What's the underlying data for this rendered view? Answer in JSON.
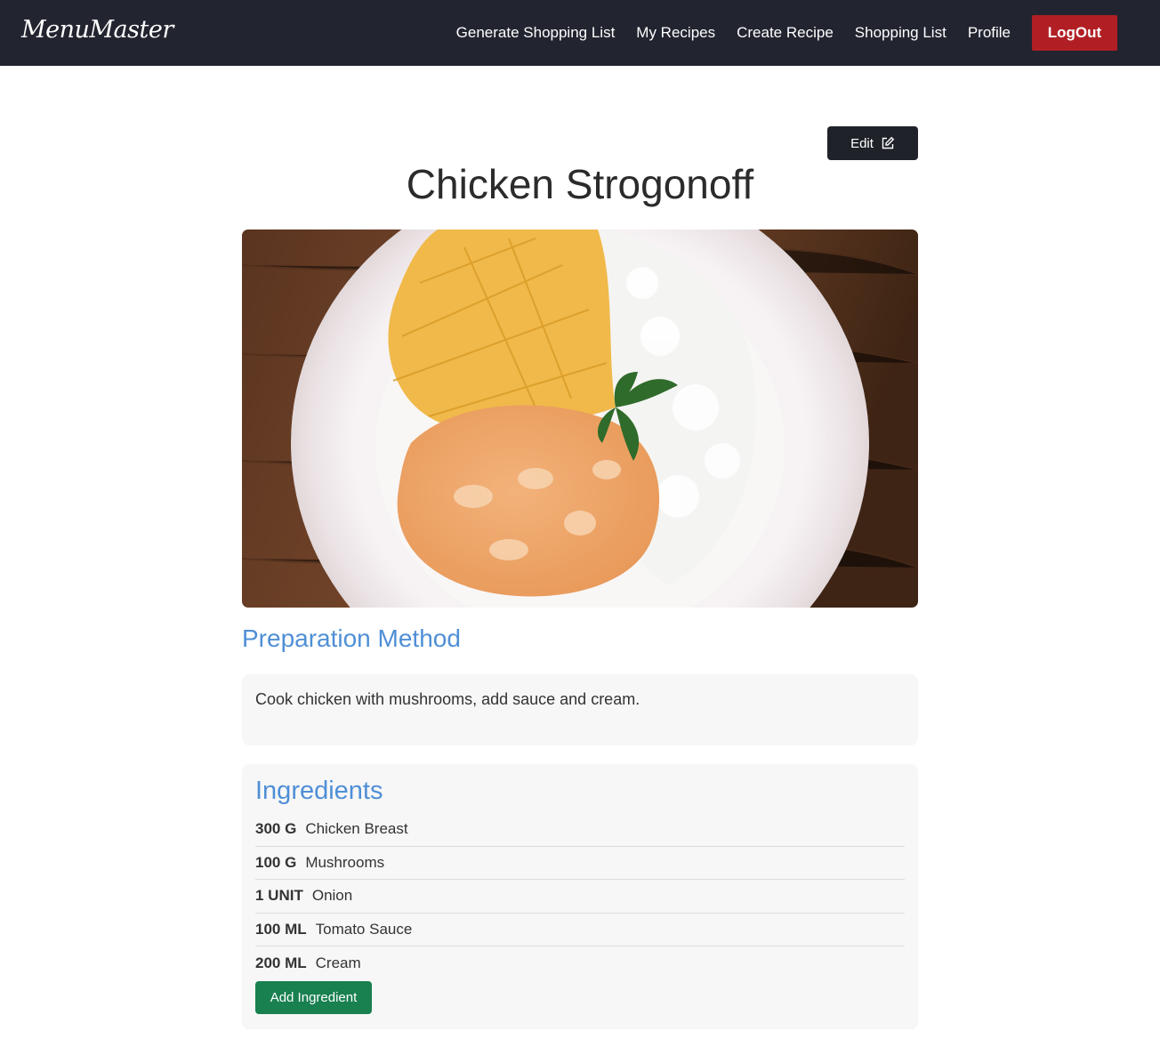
{
  "navbar": {
    "brand": "MenuMaster",
    "links": [
      "Generate Shopping List",
      "My Recipes",
      "Create Recipe",
      "Shopping List",
      "Profile"
    ],
    "logout_label": "LogOut"
  },
  "recipe": {
    "edit_label": "Edit",
    "title": "Chicken Strogonoff",
    "preparation_heading": "Preparation Method",
    "preparation_text": "Cook chicken with mushrooms, add sauce and cream.",
    "ingredients_heading": "Ingredients",
    "ingredients": [
      {
        "qty": "300 G",
        "name": "Chicken Breast"
      },
      {
        "qty": "100 G",
        "name": "Mushrooms"
      },
      {
        "qty": "1 UNIT",
        "name": "Onion"
      },
      {
        "qty": "100 ML",
        "name": "Tomato Sauce"
      },
      {
        "qty": "200 ML",
        "name": "Cream"
      }
    ],
    "add_ingredient_label": "Add Ingredient"
  },
  "colors": {
    "navbar_bg": "#222430",
    "logout": "#b11f24",
    "accent_blue": "#4f8fd6",
    "add_green": "#198050"
  }
}
